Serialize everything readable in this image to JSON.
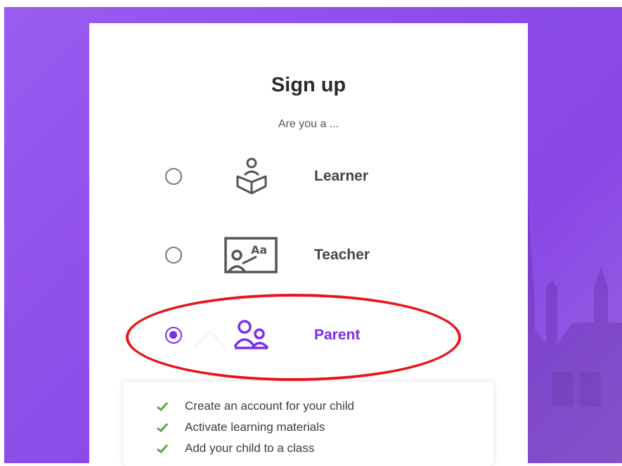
{
  "signup": {
    "title": "Sign up",
    "subtitle": "Are you a ...",
    "options": [
      {
        "label": "Learner",
        "icon": "learner-icon",
        "selected": false
      },
      {
        "label": "Teacher",
        "icon": "teacher-board-icon",
        "selected": false
      },
      {
        "label": "Parent",
        "icon": "parent-icon",
        "selected": true
      }
    ],
    "parent_benefits": [
      "Create an account for your child",
      "Activate learning materials",
      "Add your child to a class"
    ]
  },
  "colors": {
    "background": "#8c4ce8",
    "accent": "#7b2cf0",
    "check": "#4caf3a",
    "highlight_ring": "#e8141a"
  }
}
